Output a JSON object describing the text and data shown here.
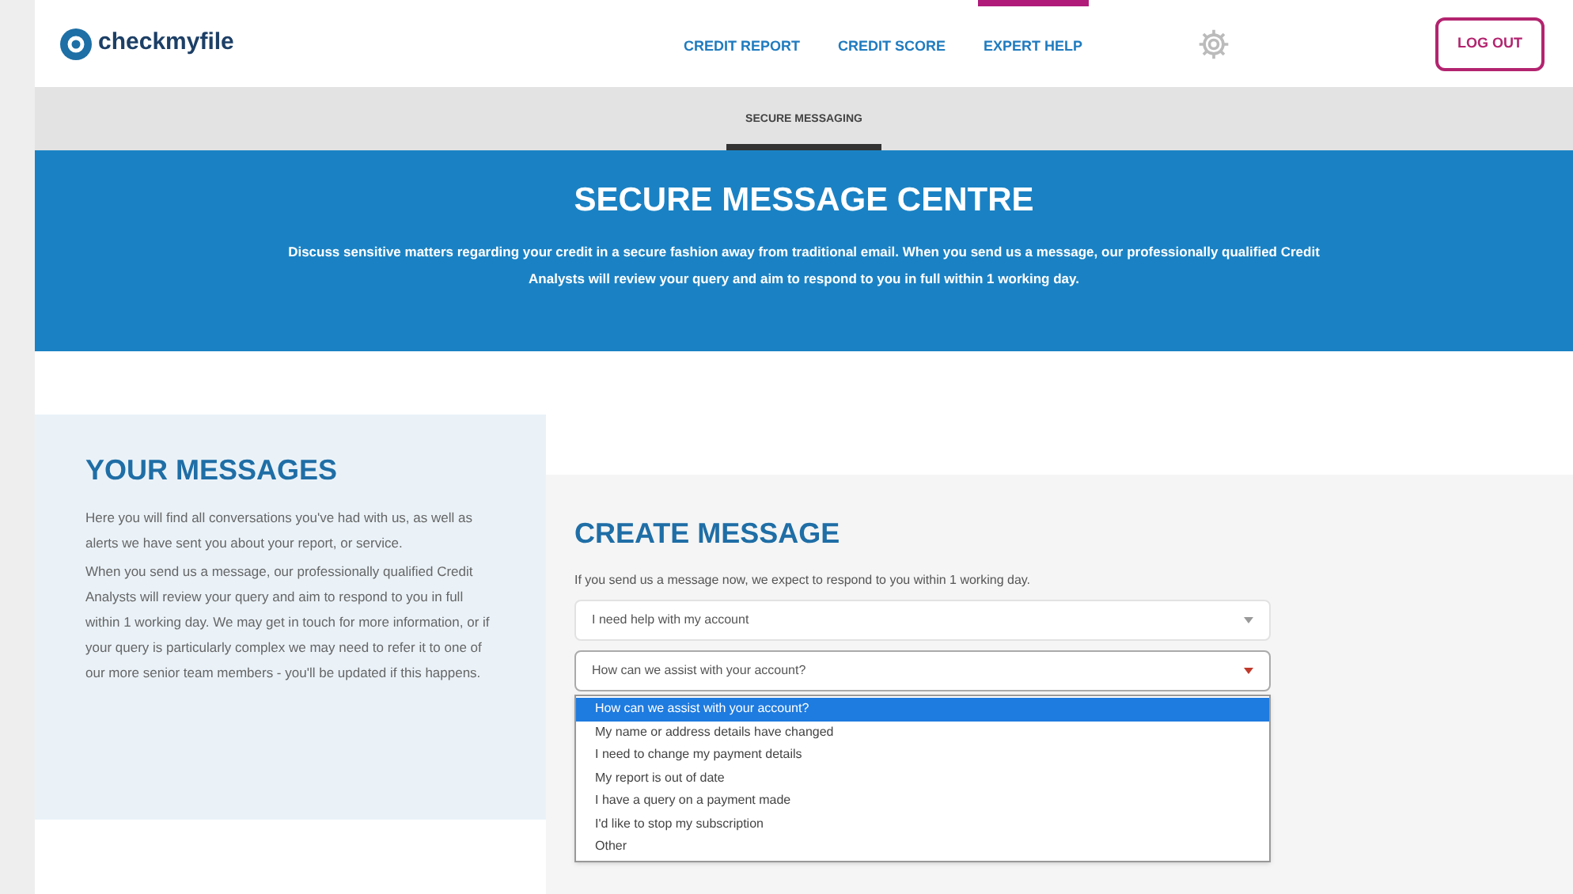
{
  "header": {
    "logo": "checkmyfile",
    "nav": [
      {
        "label": "CREDIT REPORT",
        "selected": false
      },
      {
        "label": "CREDIT SCORE",
        "selected": false
      },
      {
        "label": "EXPERT HELP",
        "selected": true
      }
    ],
    "logout": "LOG OUT"
  },
  "subnav": [
    {
      "label": "SECURE MESSAGING",
      "selected": true
    }
  ],
  "banner": {
    "title": "SECURE MESSAGE CENTRE",
    "text": "Discuss sensitive matters regarding your credit in a secure fashion away from traditional email. When you send us a message, our professionally qualified Credit Analysts will review your query and aim to respond to you in full within 1 working day."
  },
  "your_messages": {
    "title": "YOUR MESSAGES",
    "paragraphs": [
      "Here you will find all conversations you've had with us, as well as alerts we have sent you about your report, or service.",
      "When you send us a message, our professionally qualified Credit Analysts will review your query and aim to respond to you in full within 1 working day. We may get in touch for more information, or if your query is particularly complex we may need to refer it to one of our more senior team members - you'll be updated if this happens."
    ]
  },
  "create_message": {
    "title": "CREATE MESSAGE",
    "intro": "If you send us a message now, we expect to respond to you within 1 working day.",
    "selects": [
      {
        "value": "I need help with my account",
        "expanded": false
      },
      {
        "value": "How can we assist with your account?",
        "expanded": true
      }
    ],
    "options": [
      {
        "label": "How can we assist with your account?",
        "selected": true
      },
      {
        "label": "My name or address details have changed",
        "selected": false
      },
      {
        "label": "I need to change my payment details",
        "selected": false
      },
      {
        "label": "My report is out of date",
        "selected": false
      },
      {
        "label": "I have a query on a payment made",
        "selected": false
      },
      {
        "label": "I'd like to stop my subscription",
        "selected": false
      },
      {
        "label": "Other",
        "selected": false
      }
    ]
  }
}
